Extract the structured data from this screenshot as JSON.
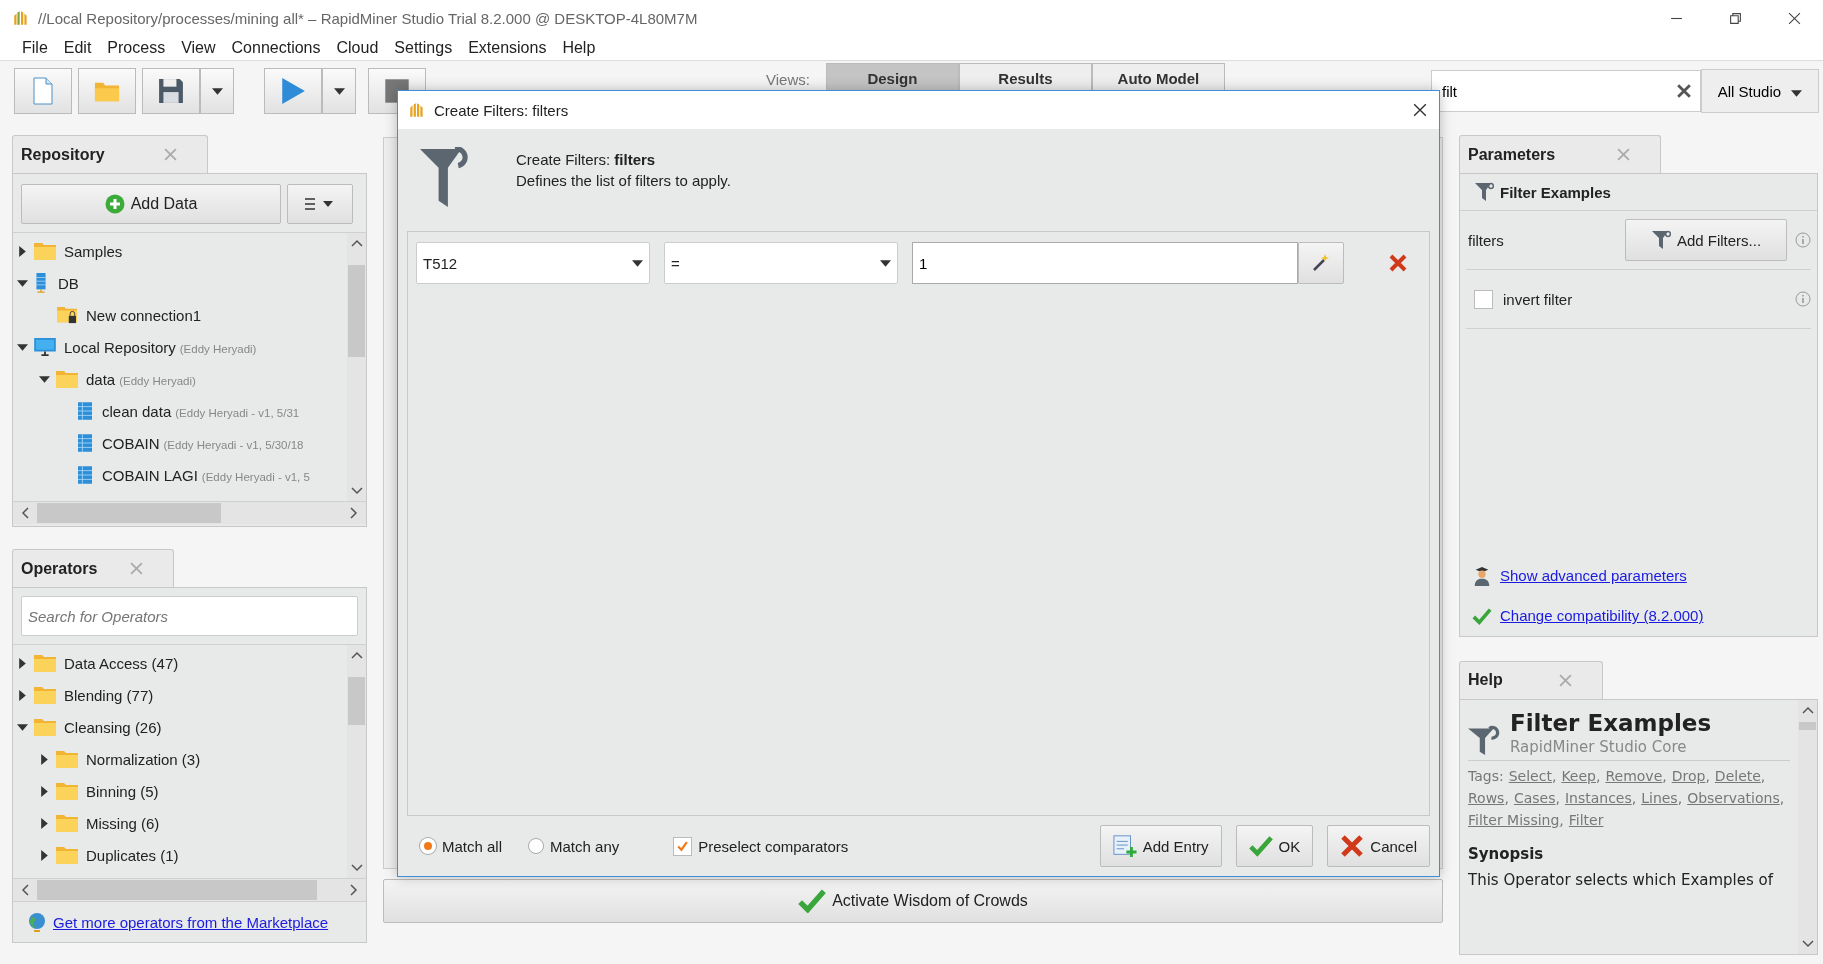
{
  "window": {
    "title": "//Local Repository/processes/mining all* – RapidMiner Studio Trial 8.2.000 @ DESKTOP-4L80M7M"
  },
  "menu": [
    "File",
    "Edit",
    "Process",
    "View",
    "Connections",
    "Cloud",
    "Settings",
    "Extensions",
    "Help"
  ],
  "toolbar": {
    "views_label": "Views:",
    "view_tabs": [
      {
        "label": "Design",
        "selected": true
      },
      {
        "label": "Results",
        "selected": false
      },
      {
        "label": "Auto Model",
        "selected": false
      }
    ],
    "search": {
      "value": "filt"
    },
    "scope_button": "All Studio"
  },
  "repository": {
    "title": "Repository",
    "add_button": "Add Data",
    "tree": [
      {
        "name": "Samples",
        "kind": "folder",
        "expanded": false
      },
      {
        "name": "DB",
        "kind": "database",
        "expanded": true,
        "children": [
          {
            "name": "New connection1",
            "kind": "connection"
          }
        ]
      },
      {
        "name": "Local Repository",
        "owner": "(Eddy Heryadi)",
        "kind": "repository",
        "expanded": true,
        "children": [
          {
            "name": "data",
            "owner": "(Eddy Heryadi)",
            "kind": "folder",
            "expanded": true,
            "children": [
              {
                "name": "clean data",
                "owner": "(Eddy Heryadi - v1, 5/31",
                "kind": "table"
              },
              {
                "name": "COBAIN",
                "owner": "(Eddy Heryadi - v1, 5/30/18",
                "kind": "table"
              },
              {
                "name": "COBAIN LAGI",
                "owner": "(Eddy Heryadi - v1, 5",
                "kind": "table"
              }
            ]
          }
        ]
      }
    ]
  },
  "operators": {
    "title": "Operators",
    "search": {
      "placeholder": "Search for Operators"
    },
    "tree": [
      {
        "name": "Data Access (47)",
        "kind": "folder",
        "expanded": false
      },
      {
        "name": "Blending (77)",
        "kind": "folder",
        "expanded": false
      },
      {
        "name": "Cleansing (26)",
        "kind": "folder",
        "expanded": true,
        "children": [
          {
            "name": "Normalization (3)",
            "kind": "folder",
            "expanded": false
          },
          {
            "name": "Binning (5)",
            "kind": "folder",
            "expanded": false
          },
          {
            "name": "Missing (6)",
            "kind": "folder",
            "expanded": false
          },
          {
            "name": "Duplicates (1)",
            "kind": "folder",
            "expanded": false
          }
        ]
      }
    ],
    "marketplace_link": "Get more operators from the Marketplace"
  },
  "process": {
    "wisdom_button": "Activate Wisdom of Crowds"
  },
  "dialog": {
    "title": "Create Filters: filters",
    "heading": "Create Filters: **filters**",
    "description": "Defines the list of filters to apply.",
    "filters": [
      {
        "attribute": "T512",
        "comparator": "=",
        "value": "1"
      }
    ],
    "match_options": [
      {
        "label": "Match all",
        "selected": true
      },
      {
        "label": "Match any",
        "selected": false
      }
    ],
    "preselect": {
      "label": "Preselect comparators",
      "checked": true
    },
    "buttons": [
      {
        "label": "Add Entry",
        "kind": "add"
      },
      {
        "label": "OK",
        "kind": "ok"
      },
      {
        "label": "Cancel",
        "kind": "cancel"
      }
    ]
  },
  "parameters": {
    "title": "Parameters",
    "operator": "Filter Examples",
    "filters_label": "filters",
    "filters_button": "Add Filters...",
    "invert": {
      "label": "invert filter",
      "checked": false
    },
    "advanced_link": "Show advanced parameters",
    "compat_link": "Change compatibility (8.2.000)"
  },
  "help": {
    "title": "Help",
    "heading": "Filter Examples",
    "subtitle": "RapidMiner Studio Core",
    "tags_label": "Tags:",
    "tags": [
      {
        "label": "Select",
        "separator": ","
      },
      {
        "label": "Keep",
        "separator": ","
      },
      {
        "label": "Remove",
        "separator": ","
      },
      {
        "label": "Drop",
        "separator": ","
      },
      {
        "label": "Delete",
        "separator": ","
      },
      {
        "label": "Rows",
        "separator": ","
      },
      {
        "label": "Cases",
        "separator": ","
      },
      {
        "label": "Instances",
        "separator": ","
      },
      {
        "label": "Lines",
        "separator": ","
      },
      {
        "label": "Observations",
        "separator": ","
      },
      {
        "label": "Filter Missing",
        "separator": ","
      },
      {
        "label": "Filter"
      }
    ],
    "section": "Synopsis",
    "synopsis": "This Operator selects which Examples of"
  }
}
